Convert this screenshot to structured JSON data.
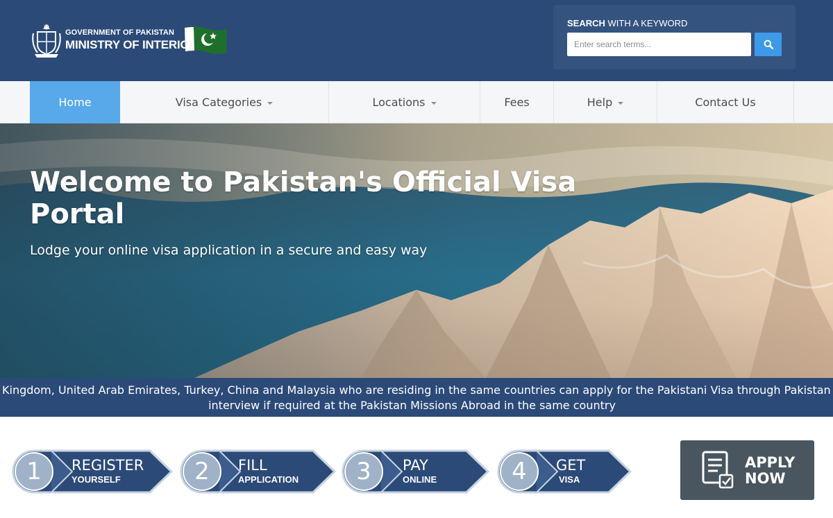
{
  "header": {
    "logo_line1": "GOVERNMENT OF PAKISTAN",
    "logo_line2": "MINISTRY OF INTERIOR",
    "search": {
      "title_bold": "SEARCH",
      "title_rest": " WITH A KEYWORD",
      "placeholder": "Enter search terms...",
      "button_icon": "search-icon"
    }
  },
  "nav": {
    "items": [
      {
        "label": "Home",
        "active": true,
        "dropdown": false
      },
      {
        "label": "Visa Categories",
        "active": false,
        "dropdown": true
      },
      {
        "label": "Locations",
        "active": false,
        "dropdown": true
      },
      {
        "label": "Fees",
        "active": false,
        "dropdown": false
      },
      {
        "label": "Help",
        "active": false,
        "dropdown": true
      },
      {
        "label": "Contact Us",
        "active": false,
        "dropdown": false
      }
    ]
  },
  "hero": {
    "title": "Welcome to Pakistan's Official Visa Portal",
    "subtitle": "Lodge your online visa application in a secure and easy way"
  },
  "ticker": {
    "line1": "Kingdom, United Arab Emirates, Turkey, China and Malaysia who are residing in the same countries can apply for the Pakistani Visa through Pakistan Online V",
    "line2": "interview if required at the Pakistan Missions Abroad in the same country"
  },
  "steps": [
    {
      "number": "1",
      "title": "REGISTER",
      "subtitle": "YOURSELF"
    },
    {
      "number": "2",
      "title": "FILL",
      "subtitle": "APPLICATION"
    },
    {
      "number": "3",
      "title": "PAY",
      "subtitle": "ONLINE"
    },
    {
      "number": "4",
      "title": "GET",
      "subtitle": "VISA"
    }
  ],
  "apply": {
    "line1": "APPLY",
    "line2": "NOW",
    "icon": "document-check-icon"
  },
  "colors": {
    "header_bg": "#2c4a78",
    "nav_active": "#58a9ea",
    "search_button": "#3d9ae8",
    "step_fill": "#2c4a78",
    "apply_bg": "#4a565f"
  }
}
